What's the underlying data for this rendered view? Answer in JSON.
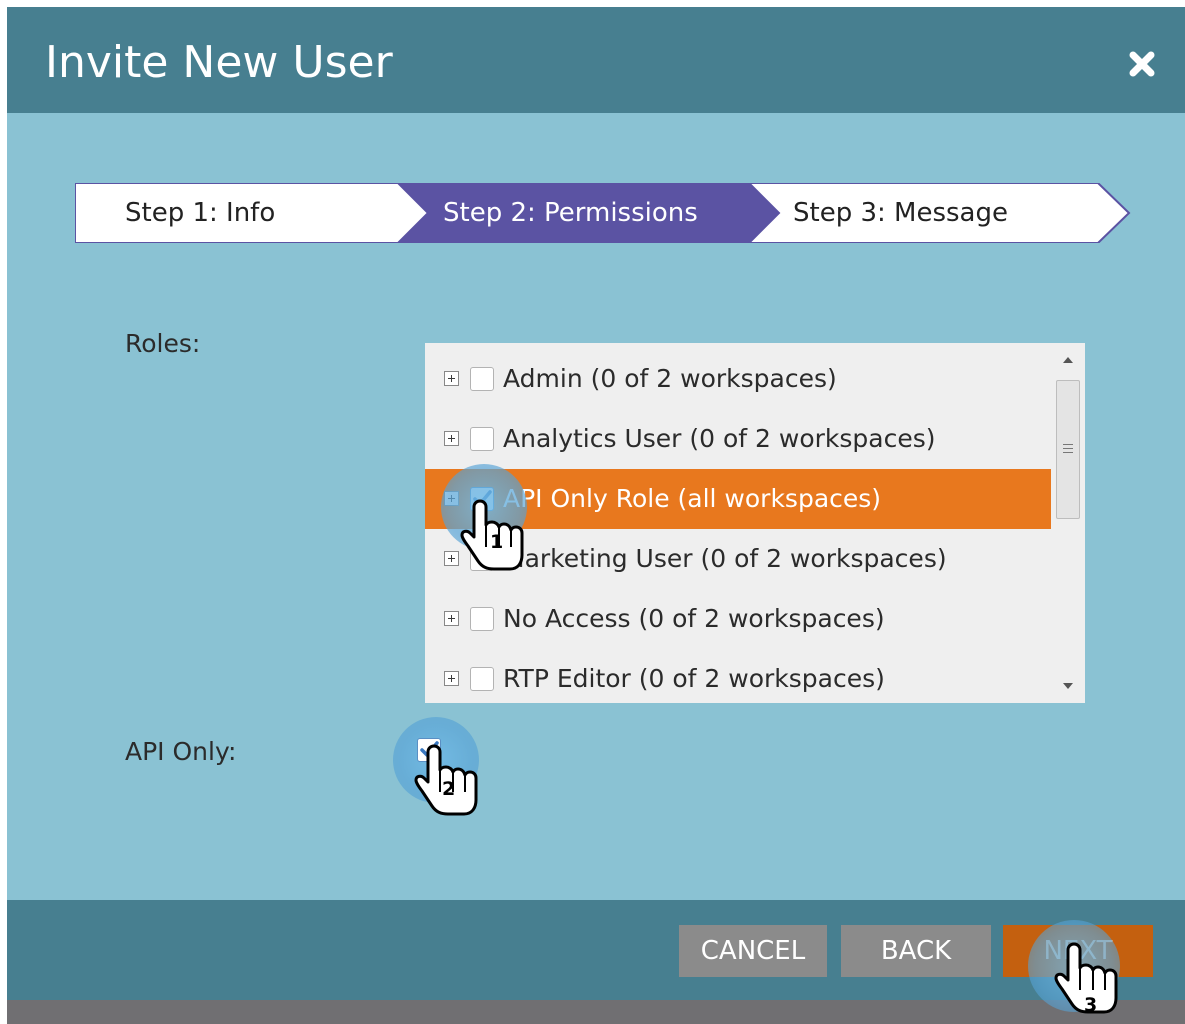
{
  "dialog": {
    "title": "Invite New User"
  },
  "wizard": {
    "steps": [
      {
        "label": "Step 1: Info"
      },
      {
        "label": "Step 2: Permissions"
      },
      {
        "label": "Step 3: Message"
      }
    ],
    "active_step": 2
  },
  "form": {
    "roles_label": "Roles:",
    "api_only_label": "API Only:",
    "api_only_checked": true
  },
  "roles": [
    {
      "label": "Admin (0 of 2 workspaces)",
      "checked": false,
      "selected": false
    },
    {
      "label": "Analytics User (0 of 2 workspaces)",
      "checked": false,
      "selected": false
    },
    {
      "label": "API Only Role (all workspaces)",
      "checked": true,
      "selected": true
    },
    {
      "label": "Marketing User (0 of 2 workspaces)",
      "checked": false,
      "selected": false
    },
    {
      "label": "No Access (0 of 2 workspaces)",
      "checked": false,
      "selected": false
    },
    {
      "label": "RTP Editor (0 of 2 workspaces)",
      "checked": false,
      "selected": false
    }
  ],
  "buttons": {
    "cancel": "CANCEL",
    "back": "BACK",
    "next": "NEXT"
  },
  "annotations": {
    "step1": "1",
    "step2": "2",
    "step3": "3"
  },
  "colors": {
    "header": "#477f90",
    "body": "#8ac2d3",
    "active_step": "#5b53a3",
    "selected_row": "#e8781e",
    "next_button": "#c4600f",
    "neutral_button": "#8b8b8b"
  }
}
